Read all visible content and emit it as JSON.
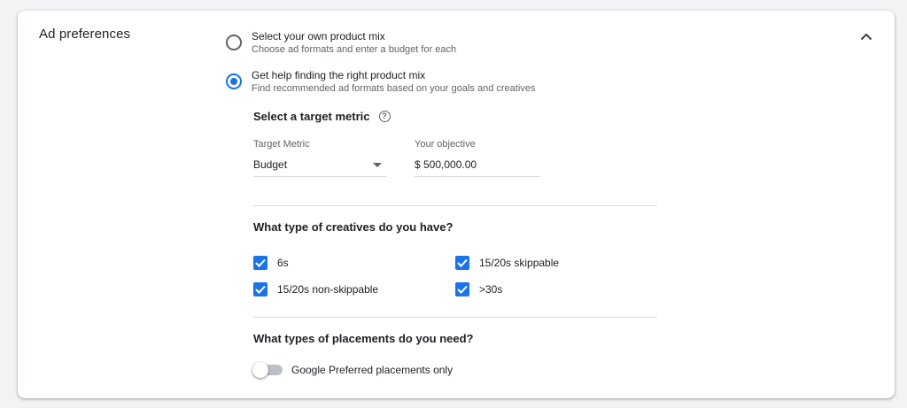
{
  "section": {
    "title": "Ad preferences"
  },
  "options": [
    {
      "label": "Select your own product mix",
      "sub": "Choose ad formats and enter a budget for each",
      "selected": false
    },
    {
      "label": "Get help finding the right product mix",
      "sub": "Find recommended ad formats based on your goals and creatives",
      "selected": true
    }
  ],
  "metric": {
    "title": "Select a target metric",
    "help_icon": "help-circle-icon",
    "target_label": "Target Metric",
    "target_value": "Budget",
    "objective_label": "Your objective",
    "objective_value": "$ 500,000.00"
  },
  "creatives": {
    "title": "What type of creatives do you have?",
    "items": [
      {
        "label": "6s",
        "checked": true
      },
      {
        "label": "15/20s skippable",
        "checked": true
      },
      {
        "label": "15/20s non-skippable",
        "checked": true
      },
      {
        "label": ">30s",
        "checked": true
      }
    ]
  },
  "placements": {
    "title": "What types of placements do you need?",
    "toggle_label": "Google Preferred placements only",
    "toggle_on": false
  },
  "colors": {
    "accent": "#1a73e8",
    "text": "#202124",
    "secondary": "#5f6368"
  }
}
